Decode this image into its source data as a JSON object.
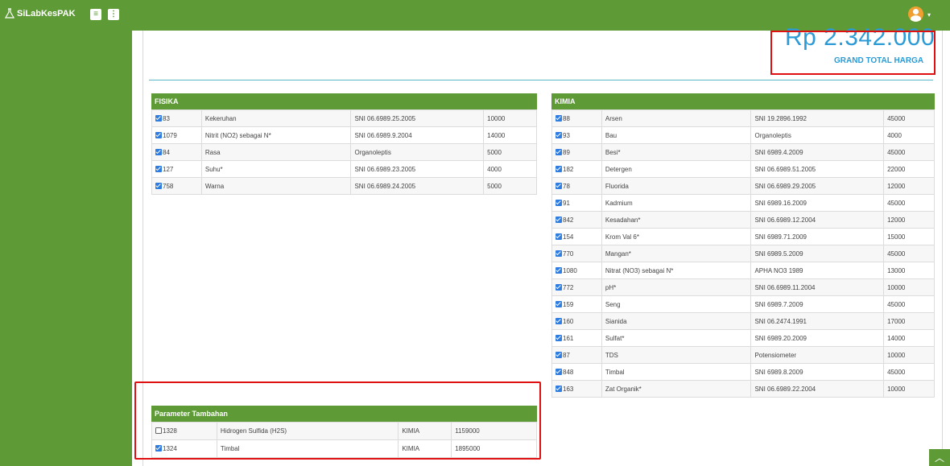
{
  "app": {
    "brand": "SiLabKesPAK"
  },
  "summary": {
    "grand_total_amount": "Rp   2.342.000",
    "grand_total_label": "GRAND TOTAL HARGA"
  },
  "fisika": {
    "title": "FISIKA",
    "rows": [
      {
        "id": "83",
        "checked": true,
        "name": "Kekeruhan",
        "method": "SNI 06.6989.25.2005",
        "price": "10000"
      },
      {
        "id": "1079",
        "checked": true,
        "name": "Nitrit (NO2) sebagai N*",
        "method": "SNI 06.6989.9.2004",
        "price": "14000"
      },
      {
        "id": "84",
        "checked": true,
        "name": "Rasa",
        "method": "Organoleptis",
        "price": "5000"
      },
      {
        "id": "127",
        "checked": true,
        "name": "Suhu*",
        "method": "SNI 06.6989.23.2005",
        "price": "4000"
      },
      {
        "id": "758",
        "checked": true,
        "name": "Warna",
        "method": "SNI 06.6989.24.2005",
        "price": "5000"
      }
    ]
  },
  "kimia": {
    "title": "KIMIA",
    "rows": [
      {
        "id": "88",
        "checked": true,
        "name": "Arsen",
        "method": "SNI 19.2896.1992",
        "price": "45000"
      },
      {
        "id": "93",
        "checked": true,
        "name": "Bau",
        "method": "Organoleptis",
        "price": "4000"
      },
      {
        "id": "89",
        "checked": true,
        "name": "Besi*",
        "method": "SNI 6989.4.2009",
        "price": "45000"
      },
      {
        "id": "182",
        "checked": true,
        "name": "Detergen",
        "method": "SNI 06.6989.51.2005",
        "price": "22000"
      },
      {
        "id": "78",
        "checked": true,
        "name": "Fluorida",
        "method": "SNI 06.6989.29.2005",
        "price": "12000"
      },
      {
        "id": "91",
        "checked": true,
        "name": "Kadmium",
        "method": "SNI 6989.16.2009",
        "price": "45000"
      },
      {
        "id": "842",
        "checked": true,
        "name": "Kesadahan*",
        "method": "SNI 06.6989.12.2004",
        "price": "12000"
      },
      {
        "id": "154",
        "checked": true,
        "name": "Krom Val 6*",
        "method": "SNI 6989.71.2009",
        "price": "15000"
      },
      {
        "id": "770",
        "checked": true,
        "name": "Mangan*",
        "method": "SNI 6989.5.2009",
        "price": "45000"
      },
      {
        "id": "1080",
        "checked": true,
        "name": "Nitrat (NO3) sebagai N*",
        "method": "APHA NO3 1989",
        "price": "13000"
      },
      {
        "id": "772",
        "checked": true,
        "name": "pH*",
        "method": "SNI 06.6989.11.2004",
        "price": "10000"
      },
      {
        "id": "159",
        "checked": true,
        "name": "Seng",
        "method": "SNI 6989.7.2009",
        "price": "45000"
      },
      {
        "id": "160",
        "checked": true,
        "name": "Sianida",
        "method": "SNI 06.2474.1991",
        "price": "17000"
      },
      {
        "id": "161",
        "checked": true,
        "name": "Sulfat*",
        "method": "SNI 6989.20.2009",
        "price": "14000"
      },
      {
        "id": "87",
        "checked": true,
        "name": "TDS",
        "method": "Potensiometer",
        "price": "10000"
      },
      {
        "id": "848",
        "checked": true,
        "name": "Timbal",
        "method": "SNI 6989.8.2009",
        "price": "45000"
      },
      {
        "id": "163",
        "checked": true,
        "name": "Zat Organik*",
        "method": "SNI 06.6989.22.2004",
        "price": "10000"
      }
    ]
  },
  "tambahan": {
    "title": "Parameter Tambahan",
    "rows": [
      {
        "id": "1328",
        "checked": false,
        "name": "Hidrogen Sulfida (H2S)",
        "category": "KIMIA",
        "price": "1159000"
      },
      {
        "id": "1324",
        "checked": true,
        "name": "Timbal",
        "category": "KIMIA",
        "price": "1895000"
      }
    ]
  },
  "colors": {
    "header_green": "#5e9b37",
    "accent_blue": "#2a9bd7",
    "highlight_red": "#e01010"
  },
  "icons": {
    "brand": "flask-icon",
    "menu": "menu-icon",
    "more": "more-vertical-icon",
    "user": "user-avatar-icon",
    "scroll_top": "chevron-up-icon"
  }
}
